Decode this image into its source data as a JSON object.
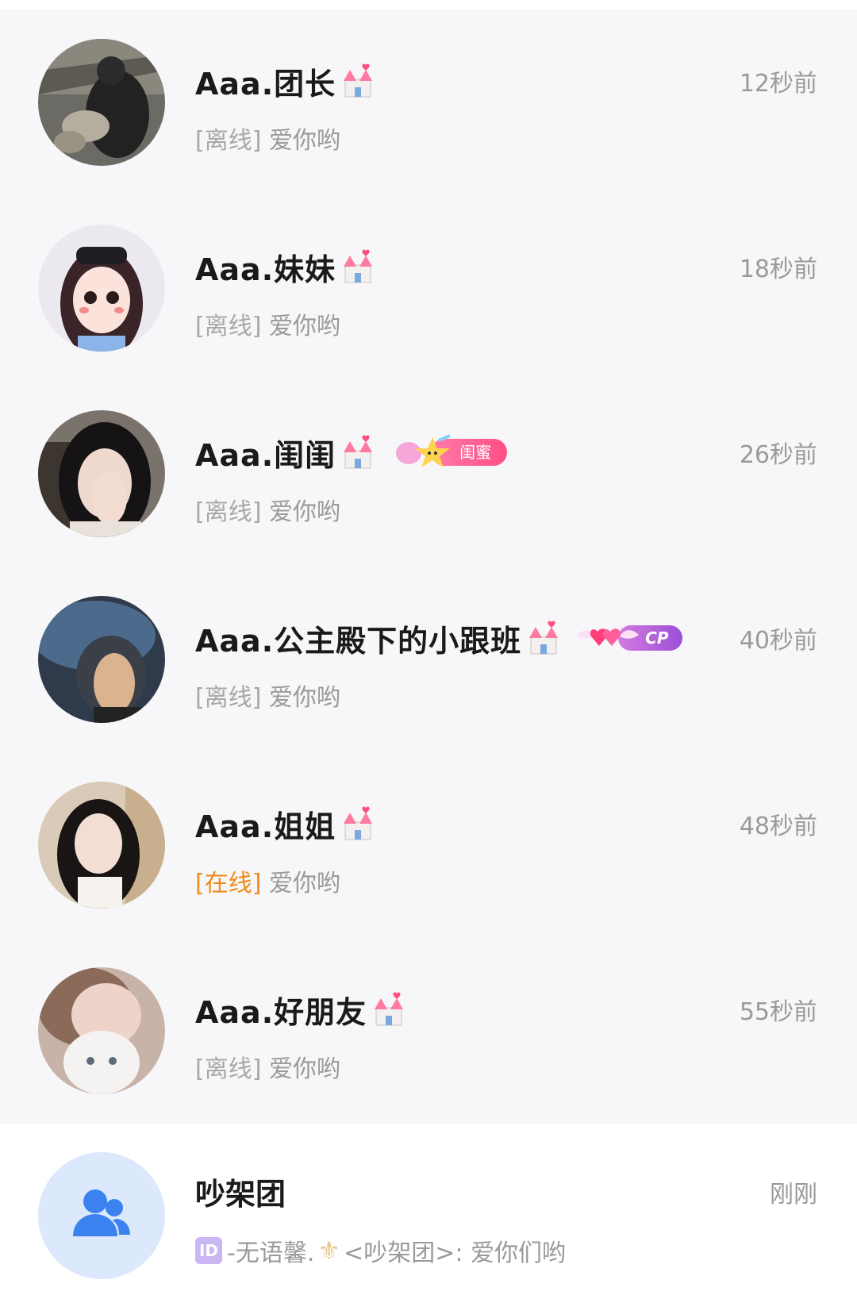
{
  "chats": [
    {
      "name": "Aaa.团长",
      "time": "12秒前",
      "status": "[离线]",
      "message": "爱你哟",
      "badge": null
    },
    {
      "name": "Aaa.妹妹",
      "time": "18秒前",
      "status": "[离线]",
      "message": "爱你哟",
      "badge": null
    },
    {
      "name": "Aaa.闺闺",
      "time": "26秒前",
      "status": "[离线]",
      "message": "爱你哟",
      "badge": "闺蜜"
    },
    {
      "name": "Aaa.公主殿下的小跟班",
      "time": "40秒前",
      "status": "[离线]",
      "message": "爱你哟",
      "badge": "CP"
    },
    {
      "name": "Aaa.姐姐",
      "time": "48秒前",
      "status": "[在线]",
      "message": "爱你哟",
      "badge": null
    },
    {
      "name": "Aaa.好朋友",
      "time": "55秒前",
      "status": "[离线]",
      "message": "爱你哟",
      "badge": null
    }
  ],
  "group": {
    "name": "吵架团",
    "time": "刚刚",
    "id_chip": "ID",
    "sender": "-无语馨.",
    "message": "<吵架团>: 爱你们哟"
  },
  "colors": {
    "background": "#f7f7f9",
    "online": "#f08c1e",
    "muted": "#9a9a9a",
    "group_avatar_bg": "#dce8fb",
    "group_icon": "#3b82f0"
  },
  "icons": {
    "castle": "castle-icon",
    "group": "group-people-icon"
  }
}
